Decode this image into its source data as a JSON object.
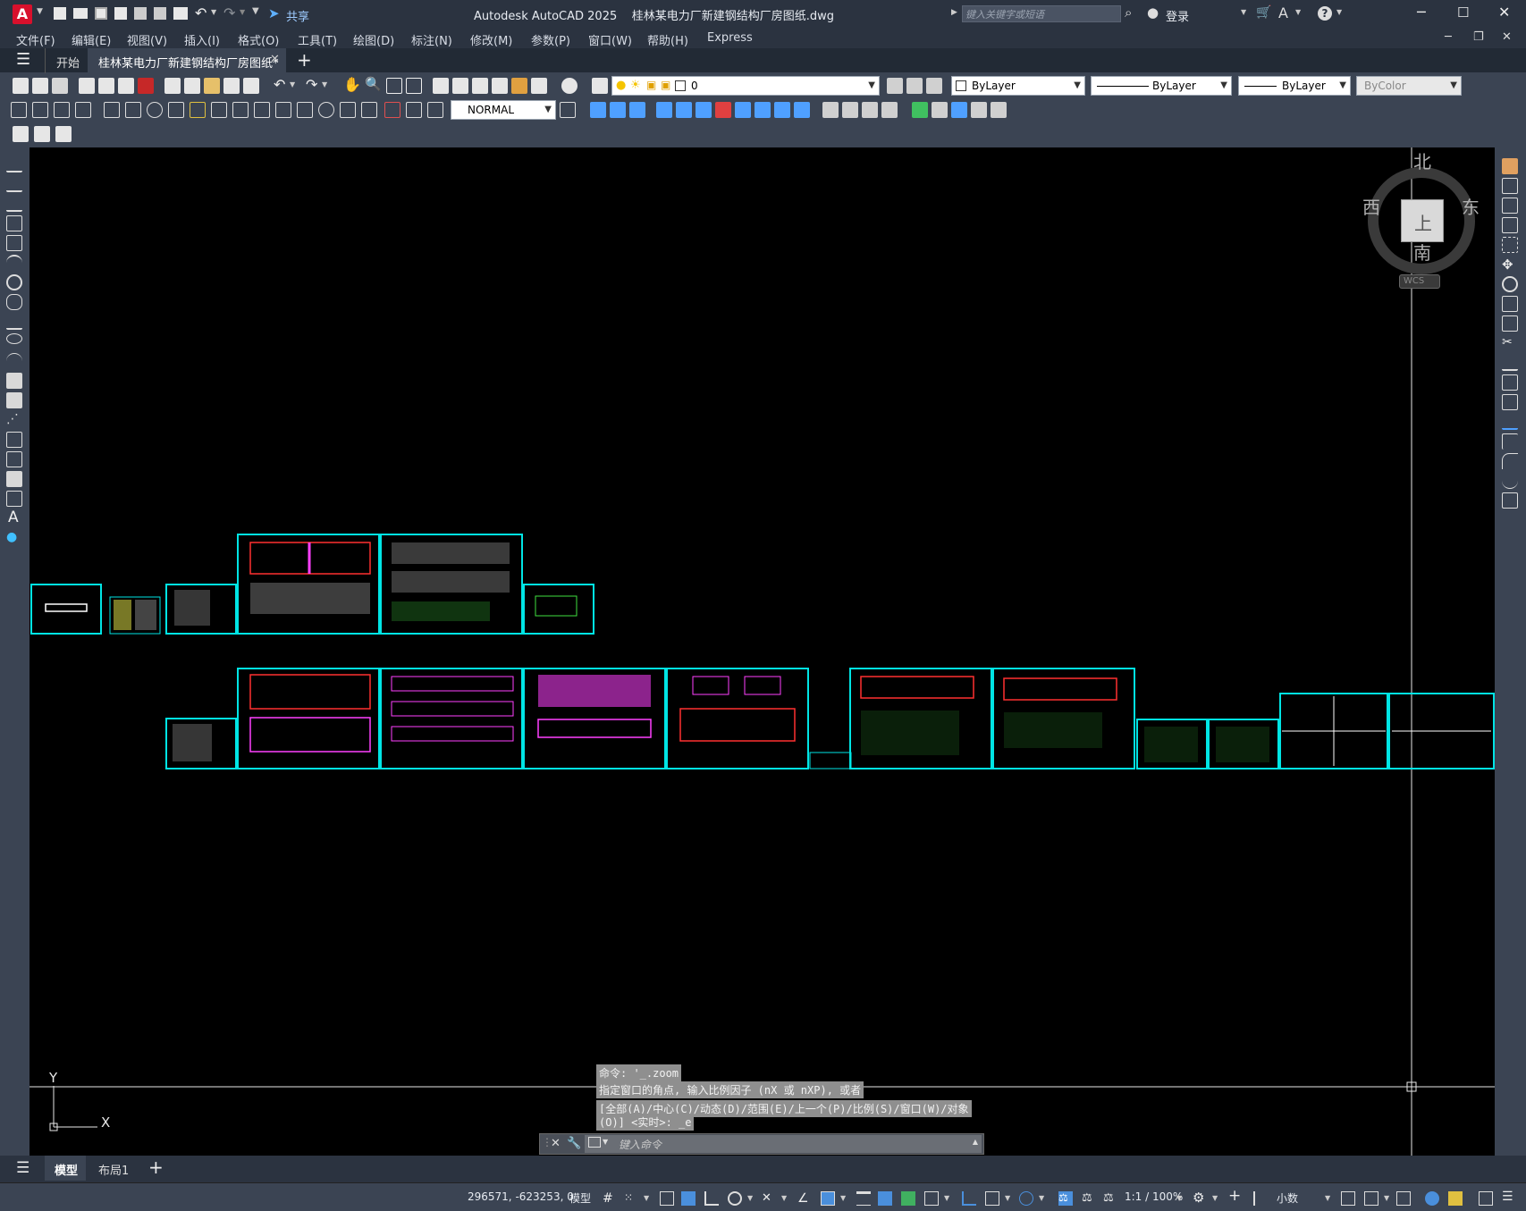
{
  "titlebar": {
    "app_logo": "A",
    "share_label": "共享",
    "title": "Autodesk AutoCAD 2025    桂林某电力厂新建钢结构厂房图纸.dwg",
    "search_placeholder": "键入关键字或短语",
    "login_label": "登录"
  },
  "menu": [
    "文件(F)",
    "编辑(E)",
    "视图(V)",
    "插入(I)",
    "格式(O)",
    "工具(T)",
    "绘图(D)",
    "标注(N)",
    "修改(M)",
    "参数(P)",
    "窗口(W)",
    "帮助(H)",
    "Express"
  ],
  "tabs": {
    "start_label": "开始",
    "file_tab_label": "桂林某电力厂新建钢结构厂房图纸*"
  },
  "properties": {
    "layer_value": "0",
    "color_value": "ByLayer",
    "linetype_value": "ByLayer",
    "lineweight_value": "ByLayer",
    "plotstyle_value": "ByColor",
    "dimstyle_value": "NORMAL"
  },
  "viewcube": {
    "north": "北",
    "south": "南",
    "east": "东",
    "west": "西",
    "face": "上",
    "wcs": "WCS"
  },
  "ucs": {
    "x_label": "X",
    "y_label": "Y"
  },
  "command": {
    "history_1": "命令: '_.zoom",
    "history_2": "指定窗口的角点, 输入比例因子 (nX 或 nXP), 或者",
    "history_3": "[全部(A)/中心(C)/动态(D)/范围(E)/上一个(P)/比例(S)/窗口(W)/对象",
    "history_4": "(O)] <实时>: _e",
    "input_placeholder": "键入命令"
  },
  "layout_tabs": {
    "model": "模型",
    "layout1": "布局1"
  },
  "status": {
    "coordinates": "296571, -623253, 0",
    "model_label": "模型",
    "scale": "1:1 / 100%",
    "units": "小数"
  },
  "colors": {
    "drawing_bg": "#000000",
    "sheet_border": "#00e5e5",
    "ui_dark": "#2b3340",
    "ui_mid": "#3b4453"
  }
}
